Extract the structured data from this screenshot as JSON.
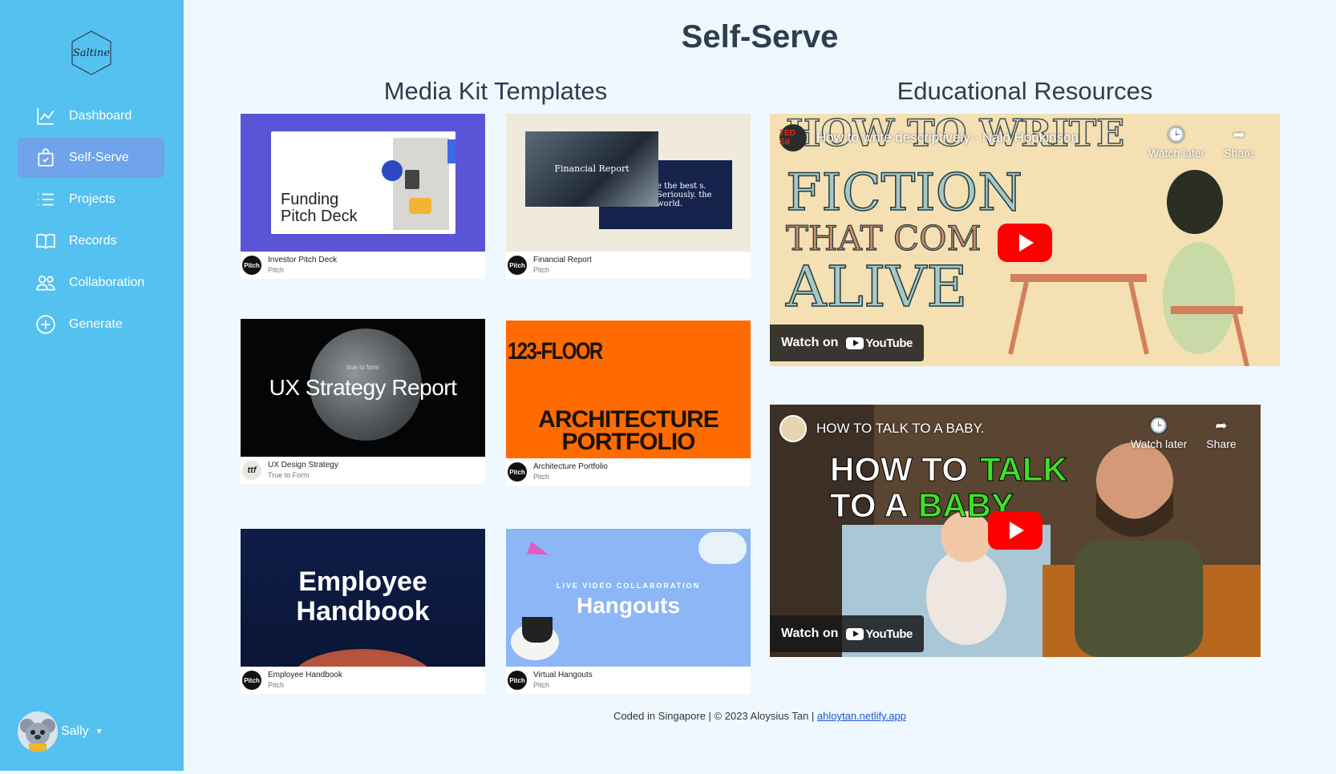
{
  "sidebar": {
    "logo_text": "Saltine",
    "items": [
      {
        "label": "Dashboard",
        "icon": "chart-line-icon"
      },
      {
        "label": "Self-Serve",
        "icon": "shopping-bag-icon",
        "active": true
      },
      {
        "label": "Projects",
        "icon": "list-icon"
      },
      {
        "label": "Records",
        "icon": "book-icon"
      },
      {
        "label": "Collaboration",
        "icon": "people-icon"
      },
      {
        "label": "Generate",
        "icon": "plus-circle-icon"
      }
    ],
    "user": {
      "name": "Sally"
    }
  },
  "page": {
    "title": "Self-Serve",
    "media_kit_title": "Media Kit Templates",
    "education_title": "Educational Resources"
  },
  "templates": [
    {
      "name": "Investor Pitch Deck",
      "author": "Pitch",
      "badge": "Pitch",
      "thumb_text": "Funding Pitch Deck"
    },
    {
      "name": "Financial Report",
      "author": "Pitch",
      "badge": "Pitch",
      "thumb_text": "Financial Report",
      "thumb_sub": "e the best s. Seriously. the world."
    },
    {
      "name": "UX Design Strategy",
      "author": "True to Form",
      "badge": "ttf",
      "thumb_text": "UX Strategy Report",
      "thumb_sub": "true to form"
    },
    {
      "name": "Architecture Portfolio",
      "author": "Pitch",
      "badge": "Pitch",
      "thumb_text": "ARCHITECTURE PORTFOLIO",
      "thumb_sub": "123-FLOOR"
    },
    {
      "name": "Employee Handbook",
      "author": "Pitch",
      "badge": "Pitch",
      "thumb_text": "Employee Handbook"
    },
    {
      "name": "Virtual Hangouts",
      "author": "Pitch",
      "badge": "Pitch",
      "thumb_text": "Hangouts",
      "thumb_sub": "LIVE VIDEO COLLABORATION"
    }
  ],
  "videos": [
    {
      "title": "How to write descriptively - Nalo Hopkinson",
      "channel": "TED Ed",
      "watch_later": "Watch later",
      "share": "Share",
      "watch_on": "Watch on",
      "youtube": "YouTube",
      "art_text_1": "HOW TO WRITE",
      "art_text_2": "FICTION",
      "art_text_3": "THAT COM",
      "art_text_4": "ALIVE"
    },
    {
      "title": "HOW TO TALK TO A BABY.",
      "watch_later": "Watch later",
      "share": "Share",
      "watch_on": "Watch on",
      "youtube": "YouTube",
      "art_text_1": "HOW TO",
      "art_text_2": "TALK",
      "art_text_3": "TO A",
      "art_text_4": "BABY"
    }
  ],
  "footer": {
    "text": "Coded in Singapore | © 2023 Aloysius Tan | ",
    "link": "ahloytan.netlify.app"
  },
  "colors": {
    "sidebar": "#55c1f0",
    "active": "#6fa3ec",
    "background": "#f0f8ff"
  }
}
